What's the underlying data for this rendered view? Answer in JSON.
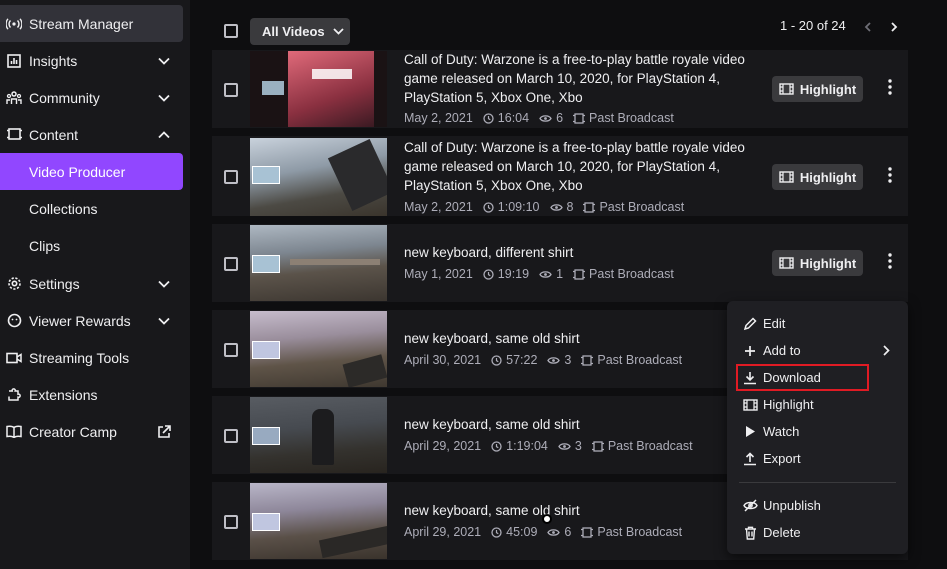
{
  "sidebar": {
    "items": [
      {
        "label": "Stream Manager",
        "icon": "broadcast-icon"
      },
      {
        "label": "Insights",
        "icon": "chart-icon",
        "expanded": false
      },
      {
        "label": "Community",
        "icon": "community-icon",
        "expanded": false
      },
      {
        "label": "Content",
        "icon": "content-icon",
        "expanded": true
      },
      {
        "label": "Video Producer"
      },
      {
        "label": "Collections"
      },
      {
        "label": "Clips"
      },
      {
        "label": "Settings",
        "icon": "gear-icon",
        "expanded": false
      },
      {
        "label": "Viewer Rewards",
        "icon": "rewards-icon",
        "expanded": false
      },
      {
        "label": "Streaming Tools",
        "icon": "camera-icon"
      },
      {
        "label": "Extensions",
        "icon": "puzzle-icon"
      },
      {
        "label": "Creator Camp",
        "icon": "book-icon"
      }
    ],
    "active_color": "#9147ff"
  },
  "toolbar": {
    "filter_label": "All Videos",
    "page_count": "1 - 20 of 24"
  },
  "videos": [
    {
      "title": "Call of Duty: Warzone is a free-to-play battle royale video game released on March 10, 2020, for PlayStation 4, PlayStation 5, Xbox One, Xbo",
      "date": "May 2, 2021",
      "duration": "16:04",
      "views": "6",
      "type": "Past Broadcast"
    },
    {
      "title": "Call of Duty: Warzone is a free-to-play battle royale video game released on March 10, 2020, for PlayStation 4, PlayStation 5, Xbox One, Xbo",
      "date": "May 2, 2021",
      "duration": "1:09:10",
      "views": "8",
      "type": "Past Broadcast"
    },
    {
      "title": "new keyboard, different shirt",
      "date": "May 1, 2021",
      "duration": "19:19",
      "views": "1",
      "type": "Past Broadcast"
    },
    {
      "title": "new keyboard, same old shirt",
      "date": "April 30, 2021",
      "duration": "57:22",
      "views": "3",
      "type": "Past Broadcast"
    },
    {
      "title": "new keyboard, same old shirt",
      "date": "April 29, 2021",
      "duration": "1:19:04",
      "views": "3",
      "type": "Past Broadcast"
    },
    {
      "title": "new keyboard, same old shirt",
      "date": "April 29, 2021",
      "duration": "45:09",
      "views": "6",
      "type": "Past Broadcast"
    }
  ],
  "highlight_label": "Highlight",
  "context_menu": {
    "items": [
      {
        "label": "Edit",
        "icon": "pencil-icon"
      },
      {
        "label": "Add to",
        "icon": "plus-icon"
      },
      {
        "label": "Download",
        "icon": "download-icon"
      },
      {
        "label": "Highlight",
        "icon": "film-icon"
      },
      {
        "label": "Watch",
        "icon": "play-icon"
      },
      {
        "label": "Export",
        "icon": "export-icon"
      },
      {
        "label": "Unpublish",
        "icon": "unpublish-icon"
      },
      {
        "label": "Delete",
        "icon": "trash-icon"
      }
    ],
    "highlighted_item": "Download",
    "highlight_color": "#e01b24"
  }
}
